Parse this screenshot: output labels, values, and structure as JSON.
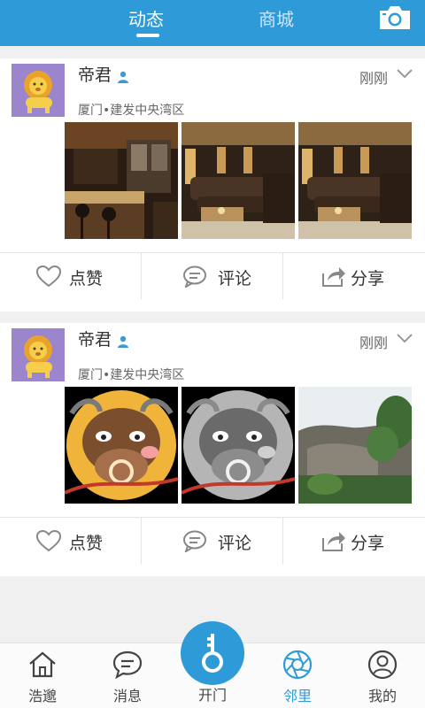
{
  "header": {
    "tabs": [
      {
        "label": "动态",
        "active": true
      },
      {
        "label": "商城",
        "active": false
      }
    ],
    "camera_icon": "camera-icon",
    "bar_color": "#2e9ad8"
  },
  "posts": [
    {
      "username": "帝君",
      "time": "刚刚",
      "location": "厦门•建发中央湾区",
      "photos": [
        "bar-interior-counter",
        "lounge-sofas",
        "lounge-sofas"
      ],
      "actions": {
        "like": "点赞",
        "comment": "评论",
        "share": "分享"
      }
    },
    {
      "username": "帝君",
      "time": "刚刚",
      "location": "厦门•建发中央湾区",
      "photos": [
        "cartoon-bull",
        "cartoon-bull-grayscale",
        "rocky-hillside"
      ],
      "actions": {
        "like": "点赞",
        "comment": "评论",
        "share": "分享"
      }
    }
  ],
  "bottom_nav": {
    "items": [
      {
        "label": "浩邈",
        "icon": "home-icon",
        "active": false
      },
      {
        "label": "消息",
        "icon": "message-icon",
        "active": false
      },
      {
        "label": "开门",
        "icon": "key-icon",
        "active": false
      },
      {
        "label": "邻里",
        "icon": "aperture-icon",
        "active": true
      },
      {
        "label": "我的",
        "icon": "user-icon",
        "active": false
      }
    ]
  }
}
